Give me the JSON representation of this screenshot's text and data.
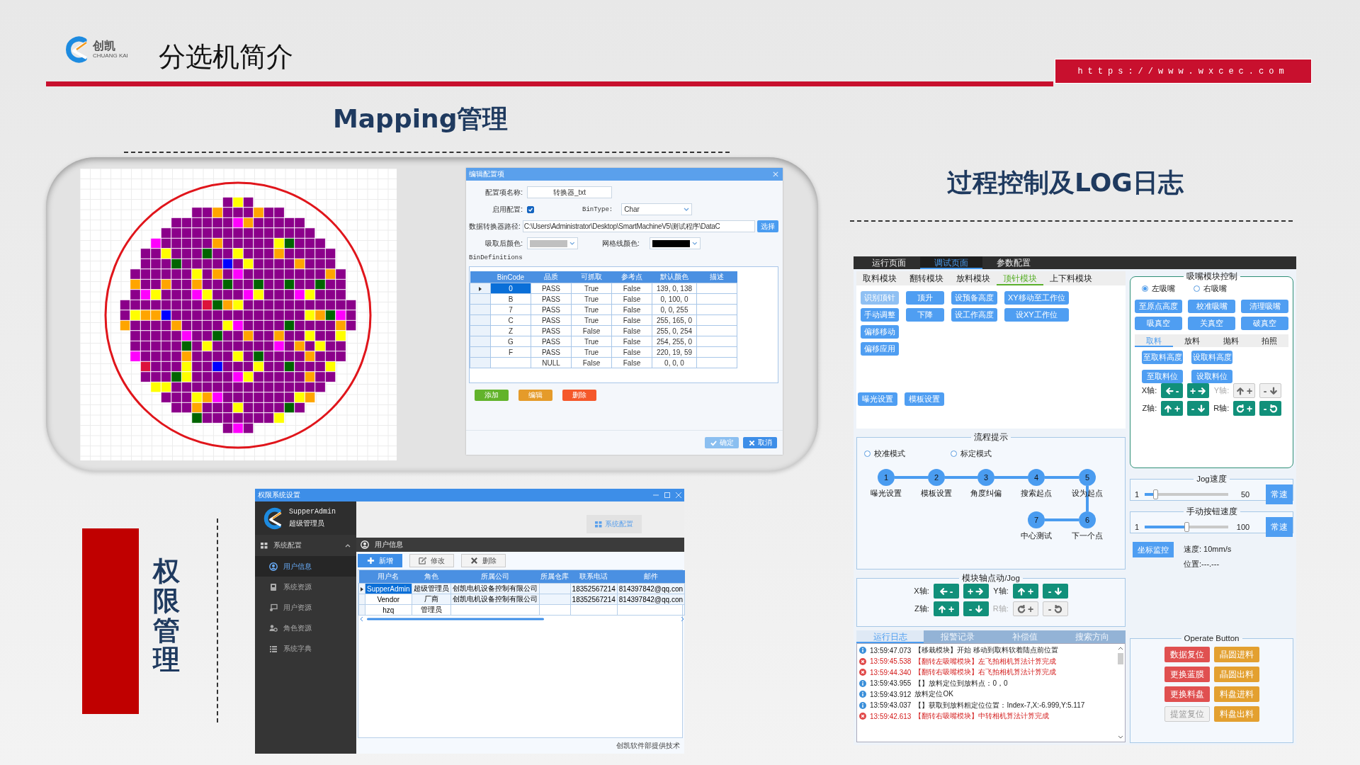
{
  "header": {
    "logo_text": "创凯",
    "logo_subtext": "CHUANG KAI",
    "title": "分选机简介",
    "url": "https://www.wxcec.com"
  },
  "mapping_title": "Mapping管理",
  "process_title": "过程控制及LOG日志",
  "permission_title": "权限管理",
  "config_dialog": {
    "title": "编辑配置项",
    "name_label": "配置项名称:",
    "name_value": "转换器_txt",
    "enable_label": "启用配置:",
    "enable_checked": true,
    "bintype_label": "BinType:",
    "bintype_value": "Char",
    "path_label": "数据转换器路径:",
    "path_value": "C:\\Users\\Administrator\\Desktop\\SmartMachineV5\\测试程序\\DataC",
    "choose_button": "选择",
    "picked_color_label": "吸取后颜色:",
    "grid_color_label": "网格线颜色:",
    "group_label": "BinDefinitions",
    "columns": [
      "BinCode",
      "品质",
      "可抓取",
      "参考点",
      "默认颜色",
      "描述"
    ],
    "rows": [
      {
        "bin_code": "0",
        "quality": "PASS",
        "pickable": "True",
        "reference": "False",
        "default_color": "139, 0, 138",
        "selected": true
      },
      {
        "bin_code": "B",
        "quality": "PASS",
        "pickable": "True",
        "reference": "False",
        "default_color": "0, 100, 0",
        "selected": false
      },
      {
        "bin_code": "7",
        "quality": "PASS",
        "pickable": "True",
        "reference": "False",
        "default_color": "0, 0, 255",
        "selected": false
      },
      {
        "bin_code": "C",
        "quality": "PASS",
        "pickable": "True",
        "reference": "False",
        "default_color": "255, 165, 0",
        "selected": false
      },
      {
        "bin_code": "Z",
        "quality": "PASS",
        "pickable": "False",
        "reference": "False",
        "default_color": "255, 0, 254",
        "selected": false
      },
      {
        "bin_code": "G",
        "quality": "PASS",
        "pickable": "True",
        "reference": "False",
        "default_color": "254, 255, 0",
        "selected": false
      },
      {
        "bin_code": "F",
        "quality": "PASS",
        "pickable": "True",
        "reference": "False",
        "default_color": "220, 19, 59",
        "selected": false
      },
      {
        "quality": "NULL",
        "pickable": "False",
        "reference": "False",
        "default_color": "0, 0, 0",
        "selected": false
      }
    ],
    "actions": [
      {
        "kind": "add",
        "label": "添加"
      },
      {
        "kind": "edit",
        "label": "编辑"
      },
      {
        "kind": "delete",
        "label": "删除"
      }
    ],
    "footer_buttons": [
      {
        "kind": "confirm",
        "label": "确定"
      },
      {
        "kind": "cancel",
        "label": "取消"
      }
    ]
  },
  "permission_window": {
    "title": "权限系统设置",
    "user_name": "SupperAdmin",
    "user_role": "超级管理员",
    "menu_group": {
      "label": "系统配置",
      "expanded": true
    },
    "menu": [
      {
        "label": "用户信息",
        "selected": true
      },
      {
        "label": "系统资源",
        "selected": false
      },
      {
        "label": "用户资源",
        "selected": false
      },
      {
        "label": "角色资源",
        "selected": false
      },
      {
        "label": "系统字典",
        "selected": false
      }
    ],
    "top_button": "系统配置",
    "section_title": "用户信息",
    "toolbar": [
      {
        "kind": "add",
        "label": "新增"
      },
      {
        "kind": "edit",
        "label": "修改"
      },
      {
        "kind": "delete",
        "label": "删除"
      }
    ],
    "columns": [
      "用户名",
      "角色",
      "所属公司",
      "所属仓库",
      "联系电话",
      "邮件"
    ],
    "rows": [
      {
        "username": "SupperAdmin",
        "role": "超级管理员",
        "company": "创凯电机设备控制有限公司",
        "phone": "18352567214",
        "email": "814397842@qq.con",
        "selected": true
      },
      {
        "username": "Vendor",
        "role": "厂商",
        "company": "创凯电机设备控制有限公司",
        "phone": "18352567214",
        "email": "814397842@qq.con",
        "selected": false
      },
      {
        "username": "hzq",
        "role": "管理员",
        "selected": false
      }
    ],
    "footer": "创凯软件部提供技术"
  },
  "control_app": {
    "top_tabs": [
      {
        "label": "运行页面",
        "selected": false
      },
      {
        "label": "调试页面",
        "selected": true
      },
      {
        "label": "参数配置",
        "selected": false
      }
    ],
    "module_tabs": [
      {
        "label": "取料模块",
        "selected": false
      },
      {
        "label": "翻转模块",
        "selected": false
      },
      {
        "label": "放料模块",
        "selected": false
      },
      {
        "label": "顶针模块",
        "selected": true
      },
      {
        "label": "上下料模块",
        "selected": false
      }
    ],
    "button_columns": [
      [
        {
          "label": "识别顶针",
          "disabled": true
        },
        {
          "label": "手动调整",
          "disabled": false
        },
        {
          "label": "偏移移动",
          "disabled": false
        },
        {
          "label": "偏移应用",
          "disabled": false
        }
      ],
      [
        {
          "label": "顶升",
          "disabled": false
        },
        {
          "label": "下降",
          "disabled": false
        }
      ],
      [
        {
          "label": "设预备高度",
          "disabled": false
        },
        {
          "label": "设工作高度",
          "disabled": false
        }
      ],
      [
        {
          "label": "XY移动至工作位",
          "disabled": false
        },
        {
          "label": "设XY工作位",
          "disabled": false
        }
      ]
    ],
    "bottom_buttons": [
      "曝光设置",
      "模板设置"
    ],
    "flow": {
      "title": "流程提示",
      "modes": [
        {
          "label": "校准模式",
          "selected": false
        },
        {
          "label": "标定模式",
          "selected": false
        }
      ],
      "steps": [
        {
          "number": "1",
          "label": "曝光设置"
        },
        {
          "number": "2",
          "label": "模板设置"
        },
        {
          "number": "3",
          "label": "角度纠偏"
        },
        {
          "number": "4",
          "label": "搜索起点"
        },
        {
          "number": "5",
          "label": "设为起点"
        },
        {
          "number": "7",
          "label": "中心测试"
        },
        {
          "number": "6",
          "label": "下一个点"
        }
      ]
    },
    "module_jog": {
      "title": "模块轴点动/Jog",
      "axes": [
        {
          "label": "X轴:",
          "disabled": false,
          "buttons": [
            {
              "kind": "left",
              "sign": "-"
            },
            {
              "kind": "right",
              "sign": "+"
            }
          ]
        },
        {
          "label": "Y轴:",
          "disabled": false,
          "buttons": [
            {
              "kind": "up",
              "sign": "+"
            },
            {
              "kind": "down",
              "sign": "-"
            }
          ]
        },
        {
          "label": "Z轴:",
          "disabled": false,
          "buttons": [
            {
              "kind": "up",
              "sign": "+"
            },
            {
              "kind": "down",
              "sign": "-"
            }
          ]
        },
        {
          "label": "R轴:",
          "disabled": true,
          "buttons": [
            {
              "kind": "cw",
              "sign": "+"
            },
            {
              "kind": "ccw",
              "sign": "-"
            }
          ]
        }
      ]
    },
    "log_tabs": [
      {
        "label": "运行日志",
        "selected": true
      },
      {
        "label": "报警记录",
        "selected": false
      },
      {
        "label": "补偿值",
        "selected": false
      },
      {
        "label": "搜索方向",
        "selected": false
      }
    ],
    "log": [
      {
        "kind": "info",
        "time": "13:59:47.073",
        "message": "【移栽模块】开始 移动到取料软着陆点前位置"
      },
      {
        "kind": "error",
        "time": "13:59:45.538",
        "message": "【翻转左吸嘴模块】左飞拍相机算法计算完成"
      },
      {
        "kind": "error",
        "time": "13:59:44.340",
        "message": "【翻转右吸嘴模块】右飞拍相机算法计算完成"
      },
      {
        "kind": "info",
        "time": "13:59:43.955",
        "message": "【】放料定位到放料点：0，0"
      },
      {
        "kind": "info",
        "time": "13:59:43.912",
        "message": "放料定位OK"
      },
      {
        "kind": "info",
        "time": "13:59:43.037",
        "message": "【】获取到放料粗定位位置：Index-7,X:-6.999,Y:5.117"
      },
      {
        "kind": "error",
        "time": "13:59:42.613",
        "message": "【翻转右吸嘴模块】中转相机算法计算完成"
      }
    ],
    "nozzle": {
      "title": "吸嘴模块控制",
      "sides": [
        {
          "label": "左吸嘴",
          "selected": true
        },
        {
          "label": "右吸嘴",
          "selected": false
        }
      ],
      "buttons": [
        "至原点高度",
        "校准吸嘴",
        "清理吸嘴",
        "吸真空",
        "关真空",
        "破真空"
      ],
      "tabs": [
        {
          "label": "取料",
          "selected": true
        },
        {
          "label": "放料",
          "selected": false
        },
        {
          "label": "抛料",
          "selected": false
        },
        {
          "label": "拍照",
          "selected": false
        }
      ],
      "tab_buttons": [
        "至取料高度",
        "设取料高度",
        "至取料位",
        "设取料位"
      ],
      "axes": [
        {
          "label": "X轴:",
          "disabled": false,
          "buttons": [
            {
              "kind": "left",
              "sign": "-"
            },
            {
              "kind": "right",
              "sign": "+"
            }
          ]
        },
        {
          "label": "Y轴:",
          "disabled": true,
          "buttons": [
            {
              "kind": "up",
              "sign": "+"
            },
            {
              "kind": "down",
              "sign": "-"
            }
          ]
        },
        {
          "label": "Z轴:",
          "disabled": false,
          "buttons": [
            {
              "kind": "up",
              "sign": "+"
            },
            {
              "kind": "down",
              "sign": "-"
            }
          ]
        },
        {
          "label": "R轴:",
          "disabled": false,
          "buttons": [
            {
              "kind": "cw",
              "sign": "+"
            },
            {
              "kind": "ccw",
              "sign": "-"
            }
          ]
        }
      ]
    },
    "jog_speed": {
      "title": "Jog速度",
      "min": "1",
      "max": "50",
      "level": 0.13,
      "button": "常速"
    },
    "button_speed": {
      "title": "手动按钮速度",
      "min": "1",
      "max": "100",
      "level": 0.5,
      "button": "常速"
    },
    "monitor": {
      "button": "坐标监控",
      "speed": "速度: 10mm/s",
      "position": "位置:---.---"
    },
    "operate": {
      "title": "Operate Button",
      "buttons": [
        {
          "label": "数据复位",
          "kind": "danger"
        },
        {
          "label": "晶圆进料",
          "kind": "warning"
        },
        {
          "label": "更换蓝膜",
          "kind": "danger"
        },
        {
          "label": "晶圆出料",
          "kind": "warning"
        },
        {
          "label": "更换料盘",
          "kind": "danger"
        },
        {
          "label": "料盘进料",
          "kind": "warning"
        },
        {
          "label": "提篮复位",
          "kind": "plain"
        },
        {
          "label": "料盘出料",
          "kind": "warning"
        }
      ]
    }
  }
}
